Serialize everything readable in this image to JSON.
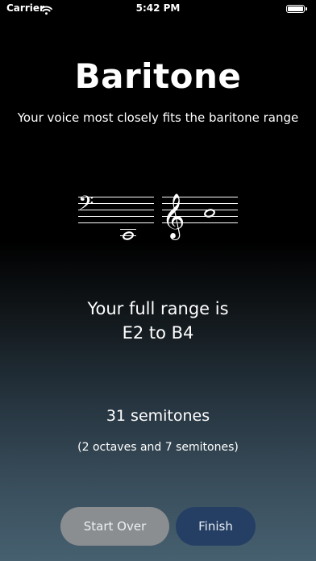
{
  "status_bar": {
    "carrier": "Carrier",
    "time": "5:42 PM"
  },
  "result": {
    "title": "Baritone",
    "subtitle": "Your voice most closely fits the baritone range",
    "range_line1": "Your full range is",
    "range_line2": "E2 to B4",
    "semitones": "31 semitones",
    "octaves_detail": "(2 octaves and 7 semitones)"
  },
  "notation": {
    "bass_clef_glyph": "𝄢",
    "treble_clef_glyph": "𝄞",
    "low_note": "E2",
    "high_note": "B4"
  },
  "buttons": {
    "start_over": "Start Over",
    "finish": "Finish"
  },
  "colors": {
    "finish_button": "#253f64",
    "start_over_button": "#8a8e91"
  }
}
